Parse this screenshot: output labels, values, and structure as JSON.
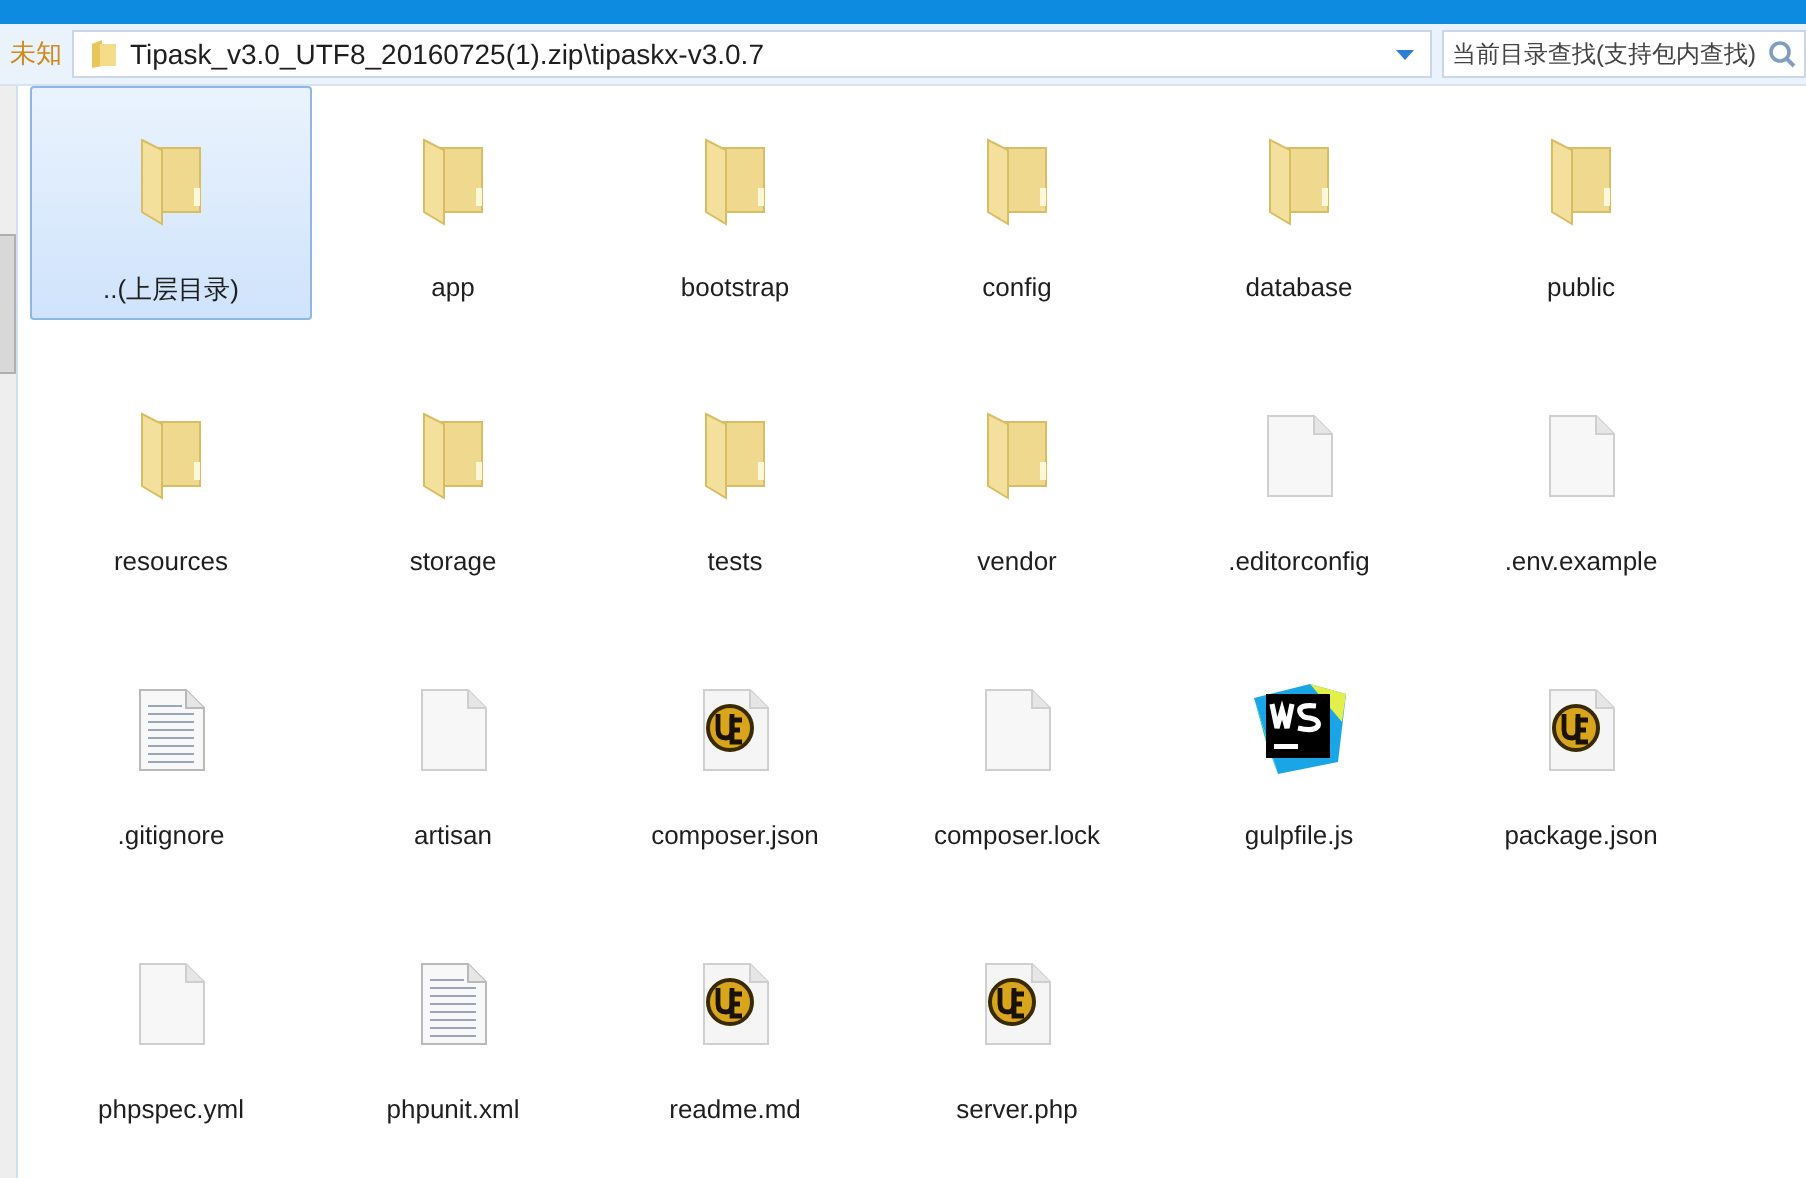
{
  "address_bar": {
    "status": "未知",
    "path": "Tipask_v3.0_UTF8_20160725(1).zip\\tipaskx-v3.0.7"
  },
  "search": {
    "placeholder": "当前目录查找(支持包内查找)"
  },
  "files": [
    {
      "name": "..(上层目录)",
      "kind": "folder",
      "selected": true
    },
    {
      "name": "app",
      "kind": "folder",
      "selected": false
    },
    {
      "name": "bootstrap",
      "kind": "folder",
      "selected": false
    },
    {
      "name": "config",
      "kind": "folder",
      "selected": false
    },
    {
      "name": "database",
      "kind": "folder",
      "selected": false
    },
    {
      "name": "public",
      "kind": "folder",
      "selected": false
    },
    {
      "name": "resources",
      "kind": "folder",
      "selected": false
    },
    {
      "name": "storage",
      "kind": "folder",
      "selected": false
    },
    {
      "name": "tests",
      "kind": "folder",
      "selected": false
    },
    {
      "name": "vendor",
      "kind": "folder",
      "selected": false
    },
    {
      "name": ".editorconfig",
      "kind": "blank",
      "selected": false
    },
    {
      "name": ".env.example",
      "kind": "blank",
      "selected": false
    },
    {
      "name": ".gitignore",
      "kind": "text",
      "selected": false
    },
    {
      "name": "artisan",
      "kind": "blank",
      "selected": false
    },
    {
      "name": "composer.json",
      "kind": "ue",
      "selected": false
    },
    {
      "name": "composer.lock",
      "kind": "blank",
      "selected": false
    },
    {
      "name": "gulpfile.js",
      "kind": "ws",
      "selected": false
    },
    {
      "name": "package.json",
      "kind": "ue",
      "selected": false
    },
    {
      "name": "phpspec.yml",
      "kind": "blank",
      "selected": false
    },
    {
      "name": "phpunit.xml",
      "kind": "text",
      "selected": false
    },
    {
      "name": "readme.md",
      "kind": "ue",
      "selected": false
    },
    {
      "name": "server.php",
      "kind": "ue",
      "selected": false
    }
  ]
}
